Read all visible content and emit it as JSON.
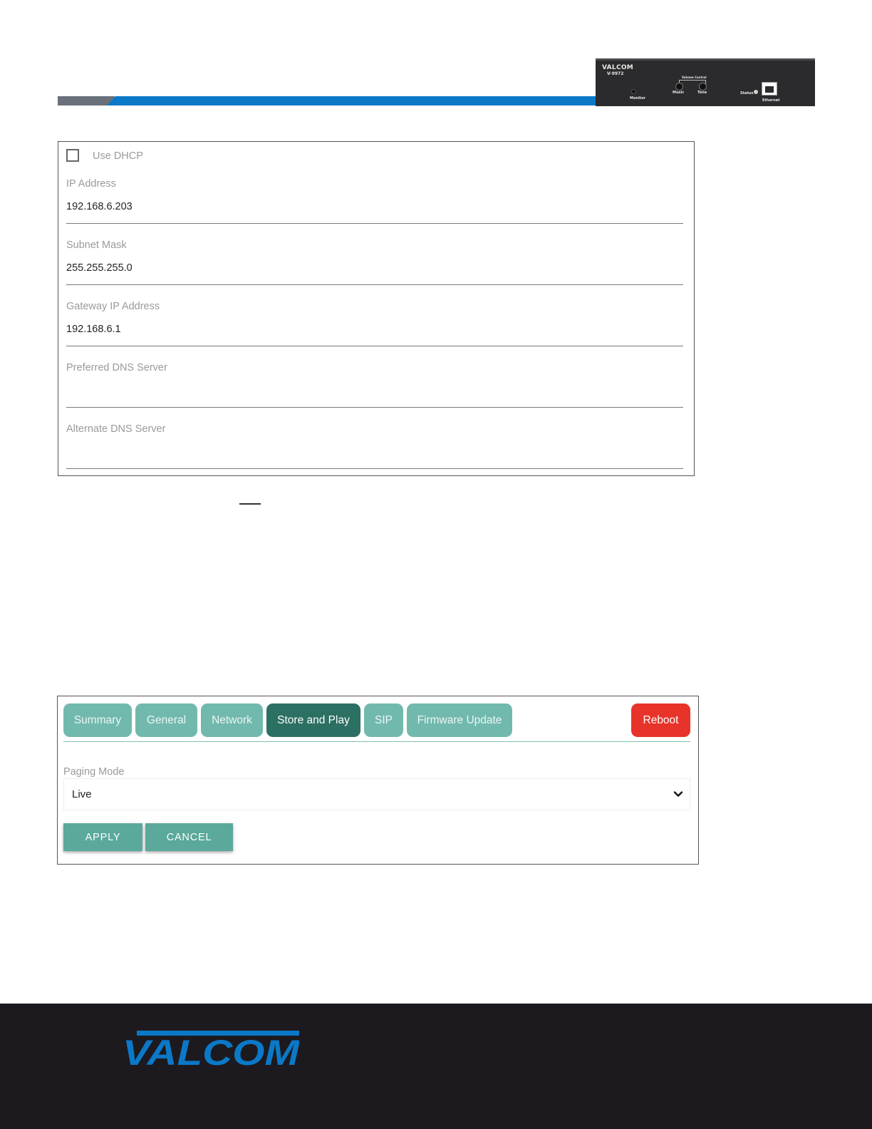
{
  "header": {
    "device_image": {
      "brand": "VALCOM",
      "model": "V-9972",
      "labels": {
        "volume_control": "Volume Control",
        "music": "Music",
        "tone": "Tone",
        "monitor": "Monitor",
        "status": "Status",
        "ethernet": "Ethernet"
      }
    }
  },
  "network_form": {
    "dhcp": {
      "label": "Use DHCP",
      "checked": false
    },
    "fields": [
      {
        "label": "IP Address",
        "value": "192.168.6.203"
      },
      {
        "label": "Subnet Mask",
        "value": "255.255.255.0"
      },
      {
        "label": "Gateway IP Address",
        "value": "192.168.6.1"
      },
      {
        "label": "Preferred DNS Server",
        "value": ""
      },
      {
        "label": "Alternate DNS Server",
        "value": ""
      }
    ]
  },
  "store_play": {
    "tabs": [
      {
        "label": "Summary",
        "active": false
      },
      {
        "label": "General",
        "active": false
      },
      {
        "label": "Network",
        "active": false
      },
      {
        "label": "Store and Play",
        "active": true
      },
      {
        "label": "SIP",
        "active": false
      },
      {
        "label": "Firmware Update",
        "active": false
      }
    ],
    "reboot_label": "Reboot",
    "paging_mode": {
      "label": "Paging Mode",
      "selected": "Live"
    },
    "apply_label": "APPLY",
    "cancel_label": "CANCEL"
  },
  "footer": {
    "logo_text": "VALCOM"
  },
  "colors": {
    "tab": "#72b9ad",
    "tab_active": "#2c6f63",
    "reboot": "#e8332a",
    "button": "#5aa99b",
    "header_blue": "#0b78c8",
    "header_grey": "#6a7079",
    "footer_bg": "#1c1a1f",
    "logo_blue": "#0b78c8"
  },
  "icons": {
    "select_chevron": "chevron-down-icon"
  }
}
